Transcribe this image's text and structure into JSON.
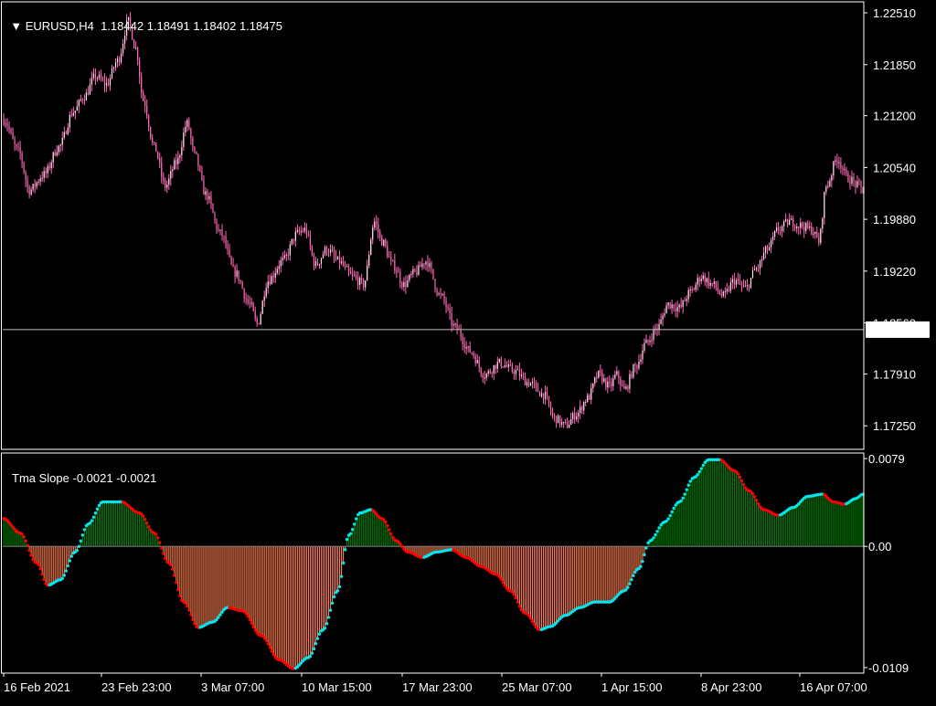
{
  "header": {
    "symbol": "EURUSD,H4",
    "open": "1.18442",
    "high": "1.18491",
    "low": "1.18402",
    "close": "1.18475"
  },
  "indicator": {
    "name": "Tma Slope",
    "value1": "-0.0021",
    "value2": "-0.0021"
  },
  "colors": {
    "background": "#000000",
    "candle": "#ff69b4",
    "frame": "#ffffff",
    "hist_pos": "#008000",
    "hist_neg": "#ff7f50",
    "slope_up": "#00e5ee",
    "slope_down": "#ff0000",
    "bid_line": "#c0c0c0"
  },
  "chart_data": [
    {
      "type": "candlestick",
      "title": "EURUSD,H4",
      "ylim": [
        1.1695,
        1.2265
      ],
      "y_ticks": [
        "1.22510",
        "1.21850",
        "1.21200",
        "1.20540",
        "1.19880",
        "1.19220",
        "1.18560",
        "1.17910",
        "1.17250"
      ],
      "current_price": "1.18475",
      "close_path": [
        [
          0,
          1.2115
        ],
        [
          8,
          1.2075
        ],
        [
          14,
          1.2025
        ],
        [
          22,
          1.2045
        ],
        [
          30,
          1.208
        ],
        [
          38,
          1.2125
        ],
        [
          44,
          1.2145
        ],
        [
          50,
          1.217
        ],
        [
          56,
          1.216
        ],
        [
          62,
          1.219
        ],
        [
          68,
          1.224
        ],
        [
          72,
          1.2205
        ],
        [
          76,
          1.214
        ],
        [
          82,
          1.208
        ],
        [
          88,
          1.203
        ],
        [
          94,
          1.206
        ],
        [
          100,
          1.211
        ],
        [
          104,
          1.207
        ],
        [
          110,
          1.202
        ],
        [
          118,
          1.197
        ],
        [
          126,
          1.192
        ],
        [
          134,
          1.188
        ],
        [
          138,
          1.1855
        ],
        [
          144,
          1.191
        ],
        [
          152,
          1.1935
        ],
        [
          160,
          1.197
        ],
        [
          164,
          1.1975
        ],
        [
          170,
          1.193
        ],
        [
          176,
          1.195
        ],
        [
          182,
          1.1935
        ],
        [
          190,
          1.1915
        ],
        [
          196,
          1.1905
        ],
        [
          202,
          1.1985
        ],
        [
          206,
          1.196
        ],
        [
          212,
          1.193
        ],
        [
          218,
          1.1905
        ],
        [
          224,
          1.192
        ],
        [
          230,
          1.1935
        ],
        [
          238,
          1.189
        ],
        [
          246,
          1.185
        ],
        [
          254,
          1.182
        ],
        [
          262,
          1.179
        ],
        [
          270,
          1.1805
        ],
        [
          278,
          1.1795
        ],
        [
          286,
          1.178
        ],
        [
          294,
          1.1765
        ],
        [
          300,
          1.1735
        ],
        [
          306,
          1.1725
        ],
        [
          312,
          1.174
        ],
        [
          318,
          1.176
        ],
        [
          324,
          1.179
        ],
        [
          330,
          1.1775
        ],
        [
          334,
          1.179
        ],
        [
          338,
          1.177
        ],
        [
          344,
          1.18
        ],
        [
          350,
          1.183
        ],
        [
          356,
          1.185
        ],
        [
          362,
          1.188
        ],
        [
          368,
          1.1875
        ],
        [
          374,
          1.1895
        ],
        [
          380,
          1.1915
        ],
        [
          386,
          1.1905
        ],
        [
          392,
          1.189
        ],
        [
          398,
          1.191
        ],
        [
          404,
          1.19
        ],
        [
          410,
          1.1925
        ],
        [
          416,
          1.195
        ],
        [
          422,
          1.1975
        ],
        [
          428,
          1.1985
        ],
        [
          434,
          1.198
        ],
        [
          440,
          1.1975
        ],
        [
          444,
          1.196
        ],
        [
          448,
          1.203
        ],
        [
          454,
          1.2065
        ],
        [
          460,
          1.204
        ],
        [
          466,
          1.203
        ],
        [
          468,
          1.2025
        ]
      ]
    },
    {
      "type": "histogram",
      "title": "Tma Slope -0.0021 -0.0021",
      "ylim": [
        -0.0114,
        0.0084
      ],
      "y_ticks": [
        "0.0079",
        "0.00",
        "-0.0109"
      ],
      "x_tick_labels": [
        "16 Feb 2021",
        "23 Feb 23:00",
        "3 Mar 07:00",
        "10 Mar 15:00",
        "17 Mar 23:00",
        "25 Mar 07:00",
        "1 Apr 15:00",
        "8 Apr 23:00",
        "16 Apr 07:00"
      ],
      "keypoints": [
        [
          0,
          0.0025
        ],
        [
          9,
          0.0012
        ],
        [
          18,
          -0.0015
        ],
        [
          24,
          -0.0035
        ],
        [
          31,
          -0.003
        ],
        [
          39,
          -0.0005
        ],
        [
          46,
          0.002
        ],
        [
          54,
          0.004
        ],
        [
          64,
          0.004
        ],
        [
          74,
          0.003
        ],
        [
          82,
          0.0012
        ],
        [
          90,
          -0.0015
        ],
        [
          98,
          -0.005
        ],
        [
          106,
          -0.0073
        ],
        [
          114,
          -0.0068
        ],
        [
          122,
          -0.0055
        ],
        [
          130,
          -0.0058
        ],
        [
          140,
          -0.008
        ],
        [
          150,
          -0.0102
        ],
        [
          158,
          -0.011
        ],
        [
          166,
          -0.01
        ],
        [
          174,
          -0.0075
        ],
        [
          182,
          -0.004
        ],
        [
          188,
          0.001
        ],
        [
          194,
          0.003
        ],
        [
          200,
          0.0033
        ],
        [
          206,
          0.0025
        ],
        [
          214,
          0.0005
        ],
        [
          220,
          -0.0005
        ],
        [
          228,
          -0.001
        ],
        [
          236,
          -0.0005
        ],
        [
          244,
          -0.0003
        ],
        [
          252,
          -0.001
        ],
        [
          260,
          -0.0018
        ],
        [
          268,
          -0.0025
        ],
        [
          276,
          -0.004
        ],
        [
          284,
          -0.006
        ],
        [
          292,
          -0.0075
        ],
        [
          298,
          -0.0072
        ],
        [
          306,
          -0.0062
        ],
        [
          314,
          -0.0055
        ],
        [
          322,
          -0.005
        ],
        [
          330,
          -0.005
        ],
        [
          338,
          -0.004
        ],
        [
          346,
          -0.002
        ],
        [
          352,
          0.0005
        ],
        [
          360,
          0.0022
        ],
        [
          368,
          0.004
        ],
        [
          376,
          0.0062
        ],
        [
          384,
          0.0078
        ],
        [
          390,
          0.0078
        ],
        [
          398,
          0.0068
        ],
        [
          406,
          0.005
        ],
        [
          414,
          0.0033
        ],
        [
          422,
          0.0028
        ],
        [
          430,
          0.0035
        ],
        [
          438,
          0.0045
        ],
        [
          446,
          0.0047
        ],
        [
          452,
          0.004
        ],
        [
          458,
          0.0038
        ],
        [
          464,
          0.0043
        ],
        [
          468,
          0.0047
        ]
      ]
    }
  ]
}
